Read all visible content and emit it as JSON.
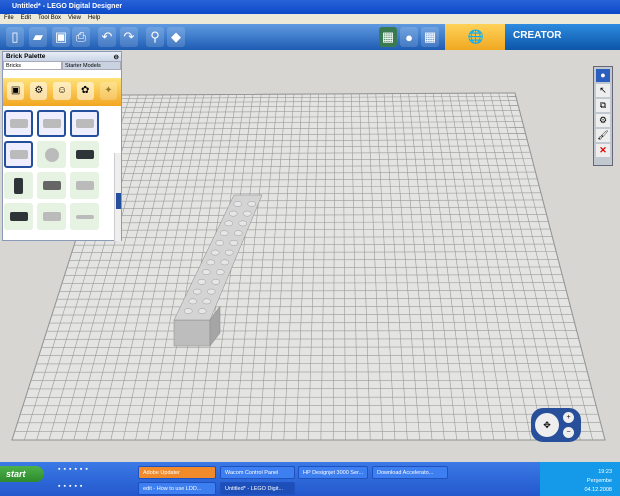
{
  "window": {
    "title": "Untitled* - LEGO Digital Designer"
  },
  "menu": [
    "File",
    "Edit",
    "Tool Box",
    "View",
    "Help"
  ],
  "toolbar": {
    "brand": "CREATOR"
  },
  "palette": {
    "title": "Brick Palette",
    "tabs": [
      "Bricks",
      "Starter Models"
    ]
  },
  "taskbar": {
    "start": "start",
    "tasks_row1": [
      "Adobe Updater",
      "Wacom Control Panel",
      "HP Designjet 3000 Ser...",
      "Download Accelerato..."
    ],
    "tasks_row2": [
      "edit - How to use LDD...",
      "Untitled* - LEGO Digit..."
    ],
    "clock": {
      "time": "19:23",
      "day": "Perşembe",
      "date": "04.12.2008"
    }
  }
}
